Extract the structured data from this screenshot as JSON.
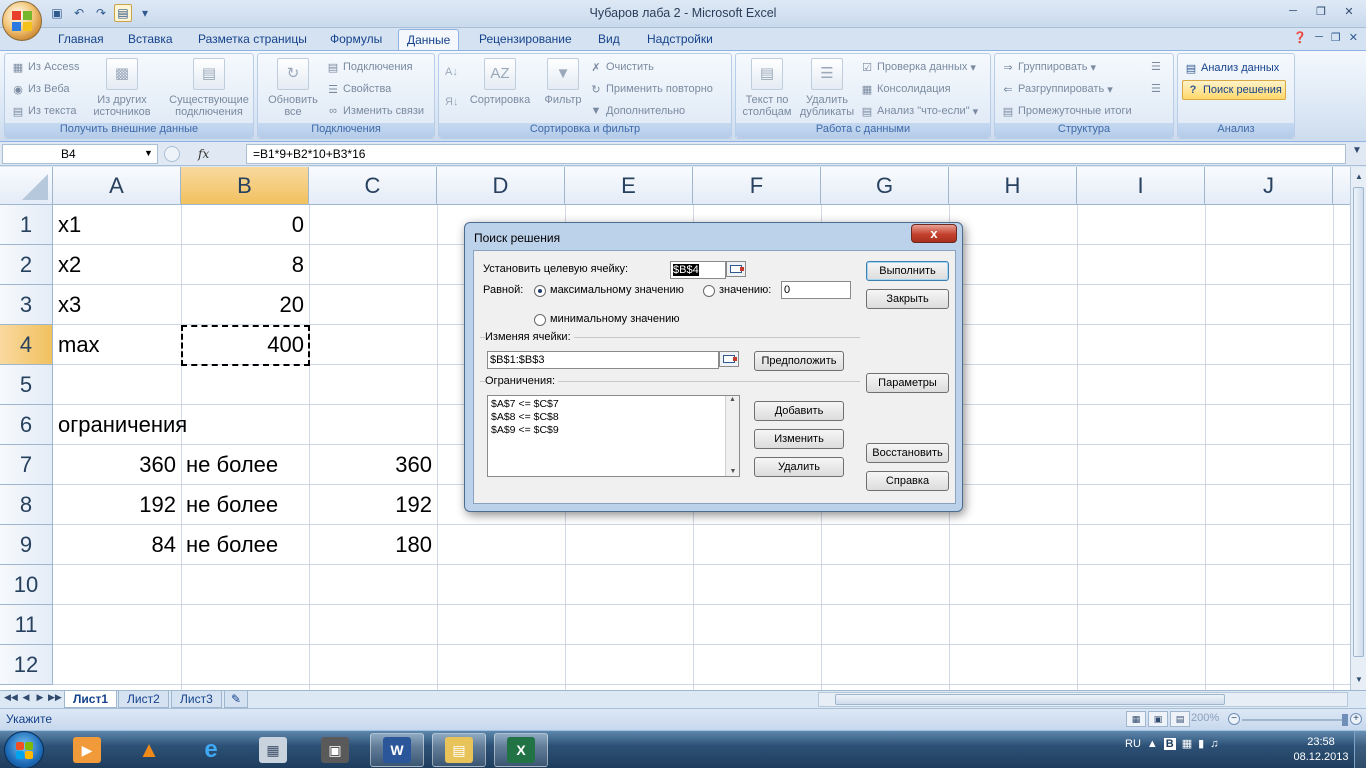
{
  "window": {
    "title": "Чубаров лаба 2 - Microsoft Excel"
  },
  "ribbon_tabs": [
    "Главная",
    "Вставка",
    "Разметка страницы",
    "Формулы",
    "Данные",
    "Рецензирование",
    "Вид",
    "Надстройки"
  ],
  "active_tab": "Данные",
  "ribbon": {
    "get_external": {
      "label": "Получить внешние данные",
      "from_access": "Из Access",
      "from_web": "Из Веба",
      "from_text": "Из текста",
      "from_other": "Из других\nисточников",
      "existing": "Существующие\nподключения"
    },
    "connections": {
      "label": "Подключения",
      "refresh_all": "Обновить\nвсе",
      "connections": "Подключения",
      "properties": "Свойства",
      "edit_links": "Изменить связи"
    },
    "sort_filter": {
      "label": "Сортировка и фильтр",
      "sort": "Сортировка",
      "filter": "Фильтр",
      "clear": "Очистить",
      "reapply": "Применить повторно",
      "advanced": "Дополнительно"
    },
    "data_tools": {
      "label": "Работа с данными",
      "text_to_columns": "Текст по\nстолбцам",
      "remove_duplicates": "Удалить\nдубликаты",
      "validation": "Проверка данных",
      "consolidate": "Консолидация",
      "what_if": "Анализ \"что-если\""
    },
    "outline": {
      "label": "Структура",
      "group": "Группировать",
      "ungroup": "Разгруппировать",
      "subtotal": "Промежуточные итоги"
    },
    "analysis": {
      "label": "Анализ",
      "data_analysis": "Анализ данных",
      "solver": "Поиск решения"
    }
  },
  "formula_bar": {
    "name_box": "B4",
    "fx": "fx",
    "formula": "=B1*9+B2*10+B3*16"
  },
  "columns": [
    "A",
    "B",
    "C",
    "D",
    "E",
    "F",
    "G",
    "H",
    "I",
    "J"
  ],
  "rows": [
    "1",
    "2",
    "3",
    "4",
    "5",
    "6",
    "7",
    "8",
    "9",
    "10",
    "11",
    "12"
  ],
  "cells": {
    "A1": "x1",
    "B1": "0",
    "A2": "x2",
    "B2": "8",
    "A3": "x3",
    "B3": "20",
    "A4": "max",
    "B4": "400",
    "A6": "ограничения",
    "A7": "360",
    "B7": "не более",
    "C7": "360",
    "A8": "192",
    "B8": "не более",
    "C8": "192",
    "A9": "84",
    "B9": "не более",
    "C9": "180"
  },
  "sheets": [
    "Лист1",
    "Лист2",
    "Лист3"
  ],
  "active_sheet": "Лист1",
  "status": {
    "mode": "Укажите",
    "zoom": "200%"
  },
  "dialog": {
    "title": "Поиск решения",
    "close": "x",
    "target_label": "Установить целевую ячейку:",
    "target_value": "$B$4",
    "equal_label": "Равной:",
    "opt_max": "максимальному значению",
    "opt_value": "значению:",
    "value_input": "0",
    "opt_min": "минимальному значению",
    "changing_label": "Изменяя ячейки:",
    "changing_value": "$B$1:$B$3",
    "guess": "Предположить",
    "constraints_label": "Ограничения:",
    "constraints": [
      "$A$7 <= $C$7",
      "$A$8 <= $C$8",
      "$A$9 <= $C$9"
    ],
    "add": "Добавить",
    "change": "Изменить",
    "delete": "Удалить",
    "solve": "Выполнить",
    "close_btn": "Закрыть",
    "options": "Параметры",
    "reset": "Восстановить",
    "help": "Справка"
  },
  "taskbar": {
    "lang": "RU",
    "time": "23:58",
    "date": "08.12.2013"
  }
}
